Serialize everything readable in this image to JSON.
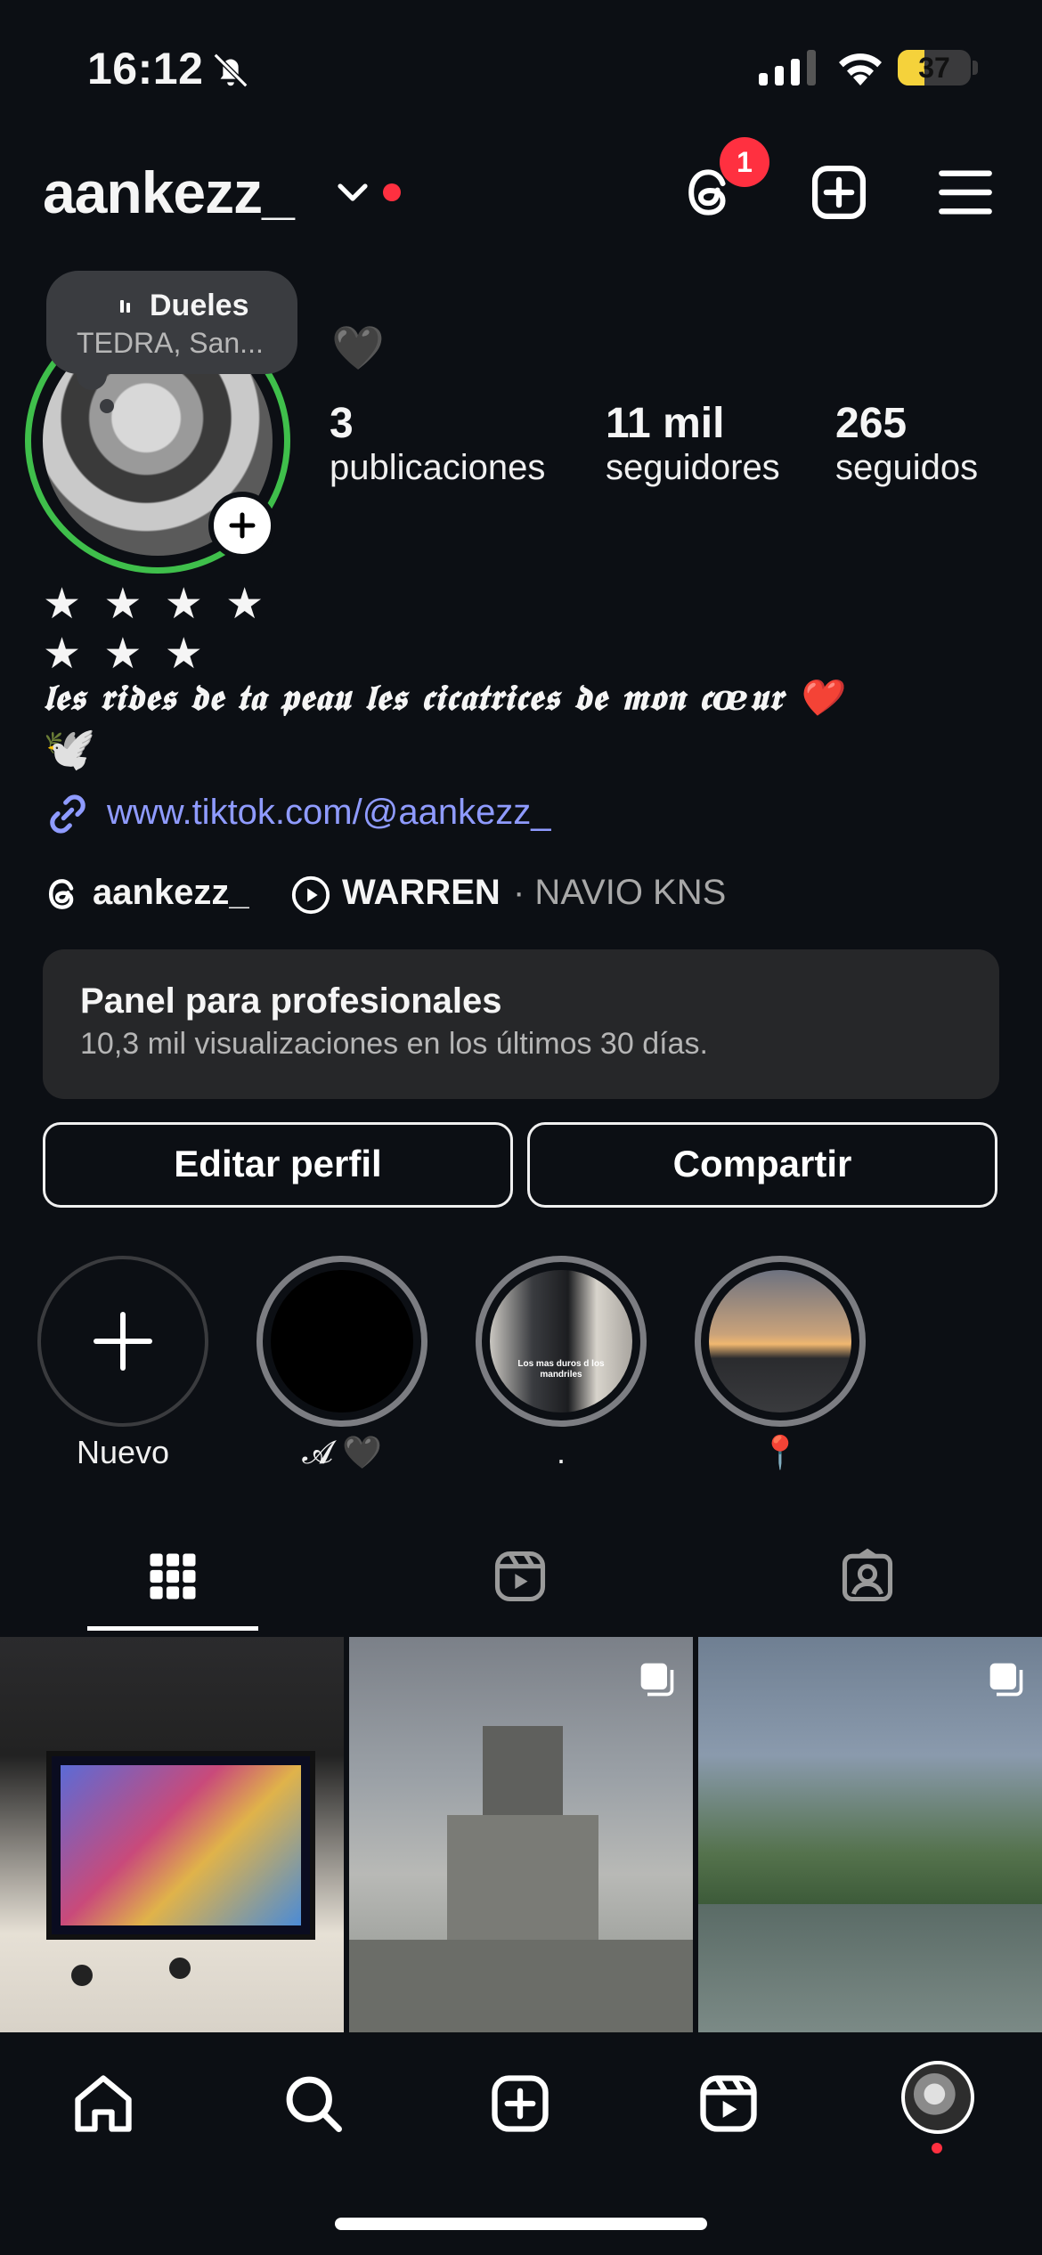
{
  "status_bar": {
    "time": "16:12",
    "battery": "37",
    "battery_level": 0.37
  },
  "header": {
    "username": "aankezz_",
    "notification_count": "1"
  },
  "note": {
    "title": "Dueles",
    "subtitle": "TEDRA, San..."
  },
  "note_heart": "🖤",
  "stats": [
    {
      "value": "3",
      "label": "publicaciones"
    },
    {
      "value": "11 mil",
      "label": "seguidores"
    },
    {
      "value": "265",
      "label": "seguidos"
    }
  ],
  "bio": {
    "stars_line1": "★ ★ ★ ★",
    "stars_line2": "★ ★ ★",
    "text": "𝖑𝖊𝖘 𝖗𝖎𝖉𝖊𝖘 𝖉𝖊 𝖙𝖆 𝖕𝖊𝖆𝖚 𝖑𝖊𝖘 𝖈𝖎𝖈𝖆𝖙𝖗𝖎𝖈𝖊𝖘 𝖉𝖊 𝖒𝖔𝖓 𝖈œ𝖚𝖗 ❤️",
    "emoji": "🕊️",
    "link": "www.tiktok.com/@aankezz_"
  },
  "threads_handle": "aankezz_",
  "music": {
    "title": "WARREN",
    "artist": "· NAVIO KNS"
  },
  "panel": {
    "title": "Panel para profesionales",
    "subtitle": "10,3 mil visualizaciones en los últimos 30 días."
  },
  "buttons": {
    "edit": "Editar perfil",
    "share": "Compartir"
  },
  "highlights": [
    {
      "label": "Nuevo"
    },
    {
      "label": "𝓐 🖤"
    },
    {
      "label": "."
    },
    {
      "label": "📍"
    }
  ],
  "highlight_caption": "Los mas duros d los mandriles",
  "colors": {
    "background": "#0c0f14",
    "accent_link": "#8f9bff",
    "notification": "#ff3040",
    "close_friends_ring": "#3fbf4b"
  }
}
